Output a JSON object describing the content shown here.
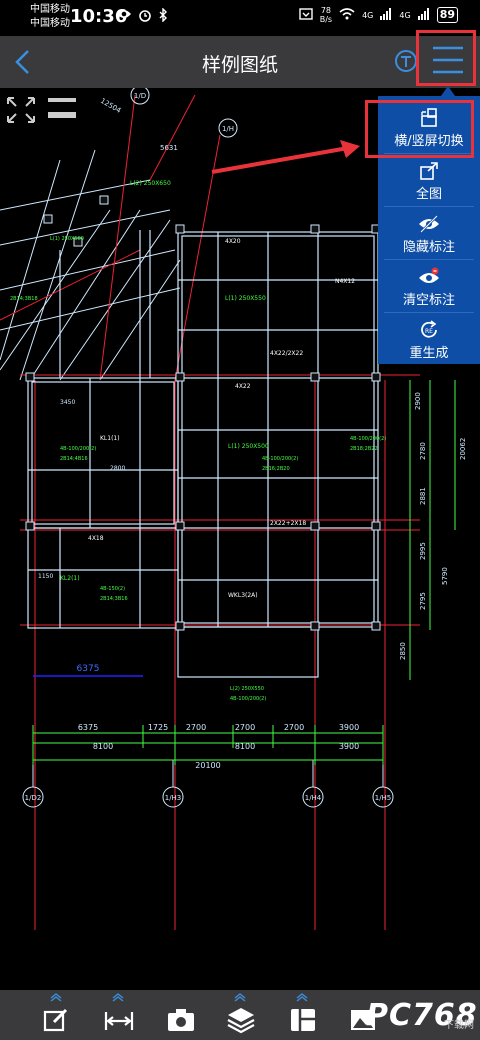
{
  "status_bar": {
    "carrier_1": "中国移动",
    "carrier_2": "中国移动",
    "time": "10:36",
    "net_speed_value": "78",
    "net_speed_unit": "B/s",
    "signal_1": "4G",
    "signal_2": "4G",
    "battery": "89"
  },
  "header": {
    "title": "样例图纸",
    "icons": {
      "back": "chevron-left-icon",
      "text_tool": "t-circle-icon",
      "menu": "hamburger-menu-icon"
    }
  },
  "popup_menu": {
    "items": [
      {
        "label": "横/竖屏切换",
        "icon": "rotate-screen-icon"
      },
      {
        "label": "全图",
        "icon": "full-view-icon"
      },
      {
        "label": "隐藏标注",
        "icon": "eye-hidden-icon"
      },
      {
        "label": "清空标注",
        "icon": "eye-clear-icon"
      },
      {
        "label": "重生成",
        "icon": "regenerate-icon"
      }
    ],
    "accent_color": "#0f4ea6",
    "highlight_color": "#e8333a"
  },
  "drawing": {
    "axis_labels": [
      "1/D",
      "1/H",
      "1/D2",
      "1/H3",
      "1/H4",
      "1/H5"
    ],
    "axis_numbers": [
      "12504",
      "5631"
    ],
    "dimension_row1": [
      "6375",
      "1725",
      "2700",
      "2700",
      "2700",
      "3900"
    ],
    "dimension_row2": [
      "8100",
      "8100",
      "3900"
    ],
    "dimension_total": "20100",
    "blue_dimension": "6375",
    "right_dimensions": [
      "2900",
      "2780",
      "20062",
      "2881",
      "2995",
      "5790",
      "2795",
      "2850"
    ],
    "left_dimensions": [
      "3450",
      "2800",
      "1150"
    ],
    "beam_labels": [
      "L(1) 250X550",
      "L(1) 250X500",
      "L(2) 250X650",
      "WKL3(2A)",
      "4X22",
      "4X20",
      "4X18",
      "2X22+2X18",
      "4X22/2X22",
      "N4X12",
      "KL1(1)",
      "KL2(1)"
    ]
  },
  "toolbar": {
    "tools": [
      "edit-icon",
      "measure-icon",
      "camera-icon",
      "layers-icon",
      "layout-icon",
      "image-icon"
    ]
  },
  "watermark": {
    "main": "PC768",
    "sub": "下载网"
  }
}
